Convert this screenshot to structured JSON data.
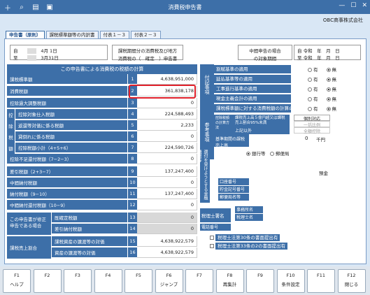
{
  "window": {
    "title": "消費税申告書"
  },
  "toolbar": {
    "icons": [
      "add-icon",
      "zoom-icon",
      "print-icon",
      "save-icon"
    ]
  },
  "company": "OBC商事株式会社",
  "tabs": [
    "申告書（原則）",
    "課税標準額等の内訳書",
    "付表１－３",
    "付表２－３"
  ],
  "period": {
    "from_label": "自",
    "from_date": "4月 1日",
    "to_label": "至",
    "to_date": "3月31日",
    "title_line1": "課税期間分の消費税及び地方",
    "title_line2": "消費税の（　確定　）申告書",
    "interim_line1": "中間申告の場合",
    "interim_line2": "の対象期間",
    "from_era": "令和",
    "to_era": "令和",
    "y": "年",
    "m": "月",
    "d": "日"
  },
  "calc_header": "この申告書による消費税の税額の計算",
  "rows": [
    {
      "label": "課税標準額",
      "no": "1",
      "value": "4,638,951,000"
    },
    {
      "label": "消費税額",
      "no": "2",
      "value": "361,838,178"
    },
    {
      "label": "控除過大調整税額",
      "no": "3",
      "value": "0"
    },
    {
      "label": "控除対象仕入税額",
      "no": "4",
      "value": "224,588,493"
    },
    {
      "label": "返還等対価に係る税額",
      "no": "5",
      "value": "2,233"
    },
    {
      "label": "貸倒れに係る税額",
      "no": "6",
      "value": "0"
    },
    {
      "label": "控除税額小計（4+5+6）",
      "no": "7",
      "value": "224,590,726"
    },
    {
      "label": "控除不足還付税額（7−2−3）",
      "no": "8",
      "value": "0"
    },
    {
      "label": "差引税額（2+3−7）",
      "no": "9",
      "value": "137,247,400"
    },
    {
      "label": "中間納付税額",
      "no": "10",
      "value": "0"
    },
    {
      "label": "納付税額（9−10）",
      "no": "11",
      "value": "137,247,400"
    },
    {
      "label": "中間納付還付税額（10−9）",
      "no": "12",
      "value": "0"
    },
    {
      "label": "既確定税額",
      "no": "13",
      "value": "0"
    },
    {
      "label": "差引納付税額",
      "no": "14",
      "value": "0"
    },
    {
      "label": "課税資産の譲渡等の対価",
      "no": "15",
      "value": "4,638,922,579"
    },
    {
      "label": "資産の譲渡等の対価",
      "no": "16",
      "value": "4,638,922,579"
    }
  ],
  "side_labels": {
    "koujo": [
      "控",
      "除",
      "税",
      "額"
    ],
    "amend": "この申告書が修正申告である場合",
    "ratio": "課税売上割合"
  },
  "notes": {
    "label1": "付記事項",
    "label2": "参考事項",
    "items": [
      {
        "text": "割賦基準の適用",
        "sel": "無"
      },
      {
        "text": "延払基準等の適用",
        "sel": "無"
      },
      {
        "text": "工事進行基準の適用",
        "sel": "無"
      },
      {
        "text": "現金主義会計の適用",
        "sel": "無"
      },
      {
        "text": "課税標準額に対する消費税額の計算の特例の適用",
        "sel": "無"
      }
    ],
    "yes": "有",
    "no": "無"
  },
  "deduction": {
    "label": "控除税額の計算方法",
    "opt1": "課税売上高５億円超又は課税売上割合95%未満",
    "opt2": "上記以外",
    "b1": "個別対応",
    "b2": "一括比例",
    "b3": "全額控除"
  },
  "base_period": {
    "label": "基準期間の課税売上高",
    "value": "0",
    "unit": "千円"
  },
  "refund": {
    "label": "還付を受けようとする金融機関等",
    "bank": "銀行等",
    "post": "郵便局",
    "deposit": "預金",
    "acct": "口座番号",
    "savings": "貯金記号番号",
    "postname": "郵便局名等"
  },
  "tax_accountant": {
    "label": "税理士署名",
    "office": "事務所名",
    "name": "税理士名",
    "tel": "電話番号"
  },
  "checks": [
    "税理士法第30条の書面提出有",
    "税理士法第33条の2の書面提出有"
  ],
  "fkeys": [
    {
      "k": "F1",
      "n": "ヘルプ"
    },
    {
      "k": "F2",
      "n": ""
    },
    {
      "k": "F3",
      "n": ""
    },
    {
      "k": "F4",
      "n": ""
    },
    {
      "k": "F5",
      "n": ""
    },
    {
      "k": "F6",
      "n": "ジャンプ"
    },
    {
      "k": "F7",
      "n": ""
    },
    {
      "k": "F8",
      "n": "再集計"
    },
    {
      "k": "F9",
      "n": ""
    },
    {
      "k": "F10",
      "n": "条件設定"
    },
    {
      "k": "F11",
      "n": ""
    },
    {
      "k": "F12",
      "n": "閉じる"
    }
  ]
}
